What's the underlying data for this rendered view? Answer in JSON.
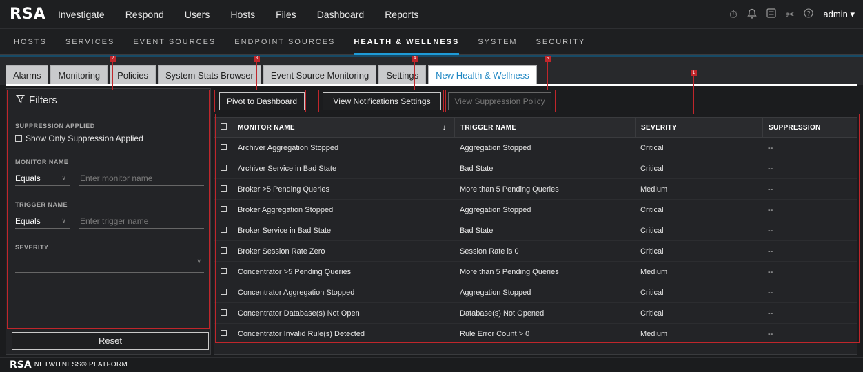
{
  "app": {
    "logo": "RSA"
  },
  "topnav": {
    "items": [
      "Investigate",
      "Respond",
      "Users",
      "Hosts",
      "Files",
      "Dashboard",
      "Reports"
    ],
    "user": "admin"
  },
  "subnav": {
    "items": [
      "HOSTS",
      "SERVICES",
      "EVENT SOURCES",
      "ENDPOINT SOURCES",
      "HEALTH & WELLNESS",
      "SYSTEM",
      "SECURITY"
    ],
    "active": "HEALTH & WELLNESS"
  },
  "tabs": {
    "items": [
      "Alarms",
      "Monitoring",
      "Policies",
      "System Stats Browser",
      "Event Source Monitoring",
      "Settings",
      "New Health & Wellness"
    ],
    "active": "New Health & Wellness"
  },
  "filters": {
    "title": "Filters",
    "suppression_label": "SUPPRESSION APPLIED",
    "suppression_checkbox": "Show Only Suppression Applied",
    "monitor_label": "MONITOR NAME",
    "monitor_operator": "Equals",
    "monitor_placeholder": "Enter monitor name",
    "trigger_label": "TRIGGER NAME",
    "trigger_operator": "Equals",
    "trigger_placeholder": "Enter trigger name",
    "severity_label": "SEVERITY",
    "reset_label": "Reset"
  },
  "toolbar": {
    "pivot": "Pivot to Dashboard",
    "notifications": "View Notifications Settings",
    "suppression": "View Suppression Policy"
  },
  "table": {
    "headers": [
      "MONITOR NAME",
      "TRIGGER NAME",
      "SEVERITY",
      "SUPPRESSION"
    ],
    "rows": [
      [
        "Archiver Aggregation Stopped",
        "Aggregation Stopped",
        "Critical",
        "--"
      ],
      [
        "Archiver Service in Bad State",
        "Bad State",
        "Critical",
        "--"
      ],
      [
        "Broker >5 Pending Queries",
        "More than 5 Pending Queries",
        "Medium",
        "--"
      ],
      [
        "Broker Aggregation Stopped",
        "Aggregation Stopped",
        "Critical",
        "--"
      ],
      [
        "Broker Service in Bad State",
        "Bad State",
        "Critical",
        "--"
      ],
      [
        "Broker Session Rate Zero",
        "Session Rate is 0",
        "Critical",
        "--"
      ],
      [
        "Concentrator >5 Pending Queries",
        "More than 5 Pending Queries",
        "Medium",
        "--"
      ],
      [
        "Concentrator Aggregation Stopped",
        "Aggregation Stopped",
        "Critical",
        "--"
      ],
      [
        "Concentrator Database(s) Not Open",
        "Database(s) Not Opened",
        "Critical",
        "--"
      ],
      [
        "Concentrator Invalid Rule(s) Detected",
        "Rule Error Count > 0",
        "Medium",
        "--"
      ]
    ]
  },
  "annotations": [
    "1",
    "2",
    "3",
    "4",
    "5"
  ],
  "footer": {
    "logo": "RSA",
    "text": "NETWITNESS® PLATFORM"
  }
}
